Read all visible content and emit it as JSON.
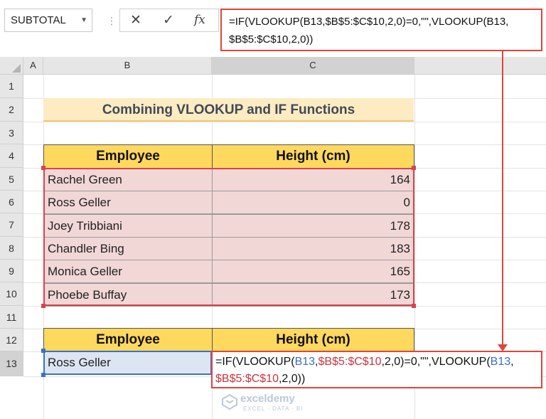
{
  "name_box": {
    "value": "SUBTOTAL"
  },
  "formula_bar": {
    "cancel_icon": "close-icon",
    "enter_icon": "check-icon",
    "fx_label": "fx",
    "line1": "=IF(VLOOKUP(B13,$B$5:$C$10,2,0)=0,\"\",VLOOKUP(B13,",
    "line2": "$B$5:$C$10,2,0))"
  },
  "columns": [
    "A",
    "B",
    "C"
  ],
  "rows": [
    "1",
    "2",
    "3",
    "4",
    "5",
    "6",
    "7",
    "8",
    "9",
    "10",
    "11",
    "12",
    "13"
  ],
  "title": "Combining VLOOKUP and IF Functions",
  "table": {
    "headers": [
      "Employee",
      "Height (cm)"
    ],
    "rows": [
      {
        "name": "Rachel Green",
        "height": "164"
      },
      {
        "name": "Ross Geller",
        "height": "0"
      },
      {
        "name": "Joey Tribbiani",
        "height": "178"
      },
      {
        "name": "Chandler Bing",
        "height": "183"
      },
      {
        "name": "Monica Geller",
        "height": "165"
      },
      {
        "name": "Phoebe Buffay",
        "height": "173"
      }
    ]
  },
  "lookup": {
    "headers": [
      "Employee",
      "Height (cm)"
    ],
    "name": "Ross Geller",
    "formula": {
      "p1": "=IF(VLOOKUP(",
      "p2": "B13",
      "p3": ",",
      "p4": "$B$5:$C$10",
      "p5": ",2,0)=0,\"\",VLOOKUP(",
      "p6": "B13",
      "p7": ",",
      "p8": "$B$5:$C$10",
      "p9": ",2,0))"
    }
  },
  "watermark": {
    "brand": "exceldemy",
    "tagline": "EXCEL · DATA · BI"
  },
  "colors": {
    "accent_red": "#e0443b",
    "header_yellow": "#ffd85e",
    "range_pink": "#f2d7d7",
    "ref_blue": "#3a6fc1"
  }
}
